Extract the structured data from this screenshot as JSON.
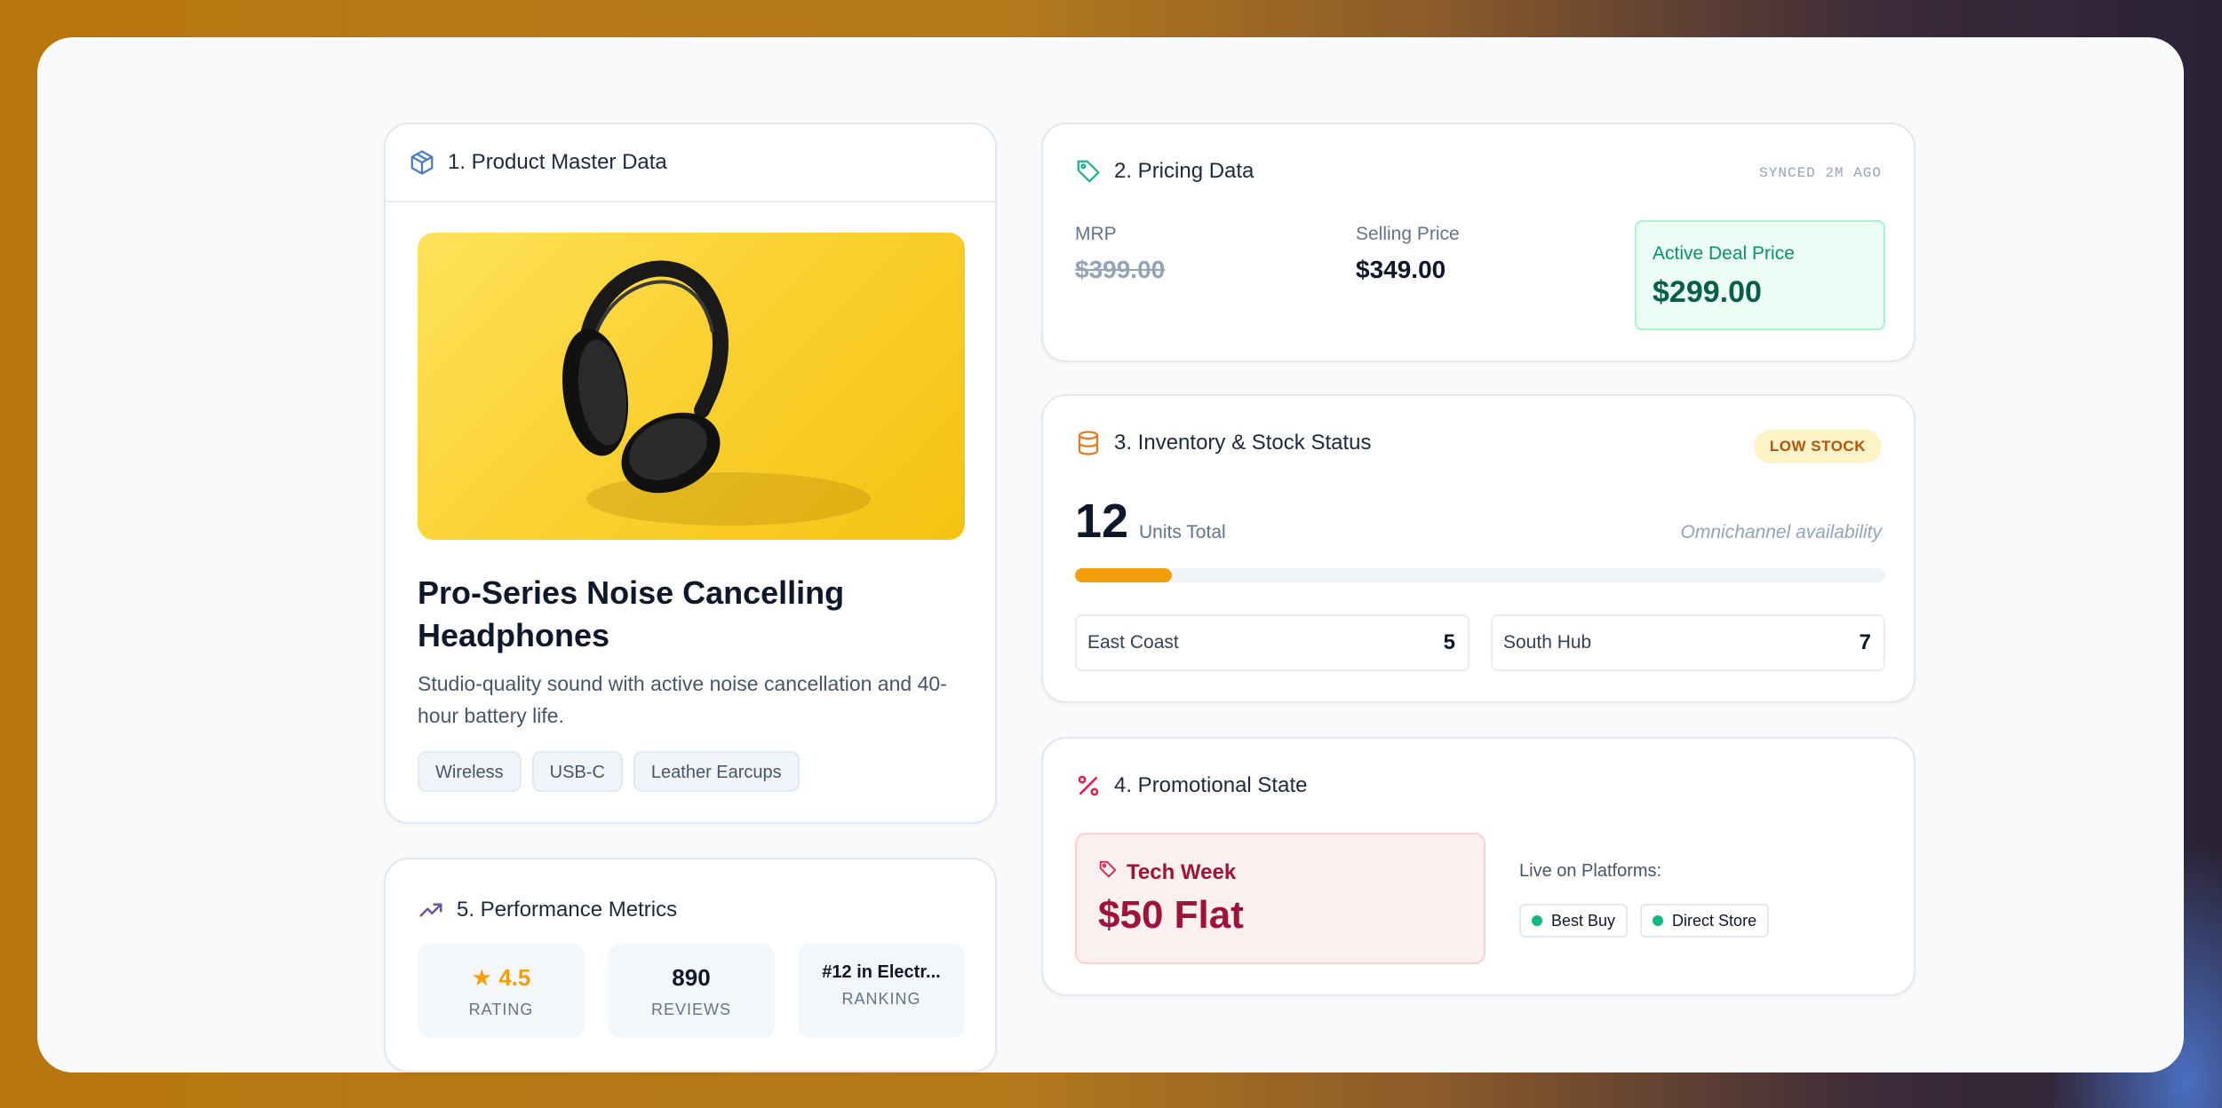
{
  "product_card": {
    "title": "1. Product Master Data",
    "name": "Pro-Series Noise Cancelling Headphones",
    "description": "Studio-quality sound with active noise cancellation and 40-hour battery life.",
    "tags": [
      "Wireless",
      "USB-C",
      "Leather Earcups"
    ]
  },
  "pricing_card": {
    "title": "2. Pricing Data",
    "sync_status": "SYNCED 2M AGO",
    "mrp_label": "MRP",
    "mrp_value": "$399.00",
    "selling_label": "Selling Price",
    "selling_value": "$349.00",
    "deal_label": "Active Deal Price",
    "deal_value": "$299.00"
  },
  "inventory_card": {
    "title": "3. Inventory & Stock Status",
    "status_badge": "LOW STOCK",
    "units_total": "12",
    "units_label": "Units Total",
    "availability_note": "Omnichannel availability",
    "stock_level_fraction": 0.12,
    "locations": [
      {
        "name": "East Coast",
        "count": "5"
      },
      {
        "name": "South Hub",
        "count": "7"
      }
    ]
  },
  "promo_card": {
    "title": "4. Promotional State",
    "promo_name": "Tech Week",
    "promo_value": "$50 Flat",
    "live_label": "Live on Platforms:",
    "platforms": [
      "Best Buy",
      "Direct Store"
    ]
  },
  "performance_card": {
    "title": "5. Performance Metrics",
    "rating": "4.5",
    "rating_label": "RATING",
    "reviews": "890",
    "reviews_label": "REVIEWS",
    "ranking": "#12 in Electr...",
    "ranking_label": "RANKING"
  },
  "colors": {
    "accent_green": "#059669",
    "warning_amber": "#f59e0b",
    "promo_red": "#9f1239",
    "star": "#f59e0b"
  },
  "icons": {
    "product": "box-icon",
    "pricing": "tag-icon",
    "inventory": "database-icon",
    "promo": "percent-icon",
    "performance": "trending-up-icon",
    "rating": "star-icon"
  }
}
